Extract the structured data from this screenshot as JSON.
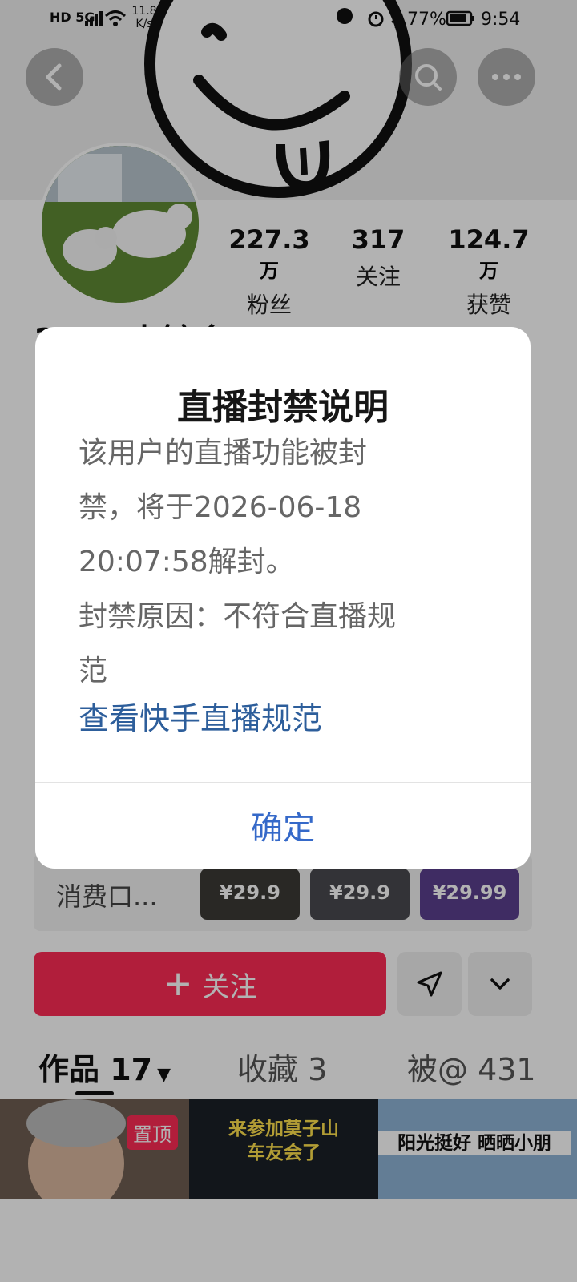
{
  "status_bar": {
    "left_indicators": "HD 5G",
    "net_speed": "11.8 K/s",
    "battery": "77%",
    "time": "9:54",
    "icons": [
      "alarm-icon",
      "bluetooth-icon",
      "battery-icon",
      "wifi-icon",
      "signal-icon"
    ]
  },
  "profile": {
    "username_partial": "3434小锌乡",
    "stats": [
      {
        "number": "227.3",
        "unit": "万",
        "label": "粉丝"
      },
      {
        "number": "317",
        "unit": "",
        "label": "关注"
      },
      {
        "number": "124.7",
        "unit": "万",
        "label": "获赞"
      }
    ]
  },
  "shop": {
    "label": "消费口...",
    "prices": [
      "¥29.9",
      "¥29.9",
      "¥29.99"
    ]
  },
  "actions": {
    "follow_label": "关注"
  },
  "tabs": [
    {
      "label": "作品 17"
    },
    {
      "label": "收藏 3"
    },
    {
      "label": "被@ 431"
    }
  ],
  "grid": {
    "pinned_label": "置顶",
    "cell2_text_line1": "来参加莫子山",
    "cell2_text_line2": "车友会了",
    "cell3_text": "阳光挺好 晒晒小朋"
  },
  "modal": {
    "title": "直播封禁说明",
    "body_lines": [
      "该用户的直播功能被封",
      "禁，将于2026-06-18",
      "20:07:58解封。",
      "封禁原因：不符合直播规",
      "范"
    ],
    "rules_link": "查看快手直播规范",
    "confirm_label": "确定"
  },
  "colors": {
    "accent_red": "#fe2c55",
    "link_blue": "#2d5e9b",
    "confirm_blue": "#3569c9"
  }
}
